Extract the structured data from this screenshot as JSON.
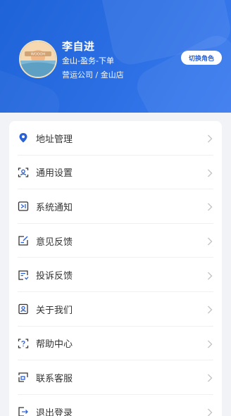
{
  "profile": {
    "avatar_text": "WOOOH",
    "name": "李自进",
    "role": "金山-盈务-下单",
    "org": "营运公司 / 金山店",
    "switch_role_label": "切换角色"
  },
  "menu": {
    "items": [
      {
        "label": "地址管理",
        "icon": "location-pin-icon"
      },
      {
        "label": "通用设置",
        "icon": "user-settings-icon"
      },
      {
        "label": "系统通知",
        "icon": "notification-icon"
      },
      {
        "label": "意见反馈",
        "icon": "edit-feedback-icon"
      },
      {
        "label": "投诉反馈",
        "icon": "complaint-icon"
      },
      {
        "label": "关于我们",
        "icon": "about-user-icon"
      },
      {
        "label": "帮助中心",
        "icon": "help-icon"
      },
      {
        "label": "联系客服",
        "icon": "customer-service-icon"
      },
      {
        "label": "退出登录",
        "icon": "logout-icon"
      }
    ]
  },
  "colors": {
    "header_primary": "#1f63d8",
    "icon_blue": "#2a62d6",
    "page_bg": "#f2f3f7"
  }
}
